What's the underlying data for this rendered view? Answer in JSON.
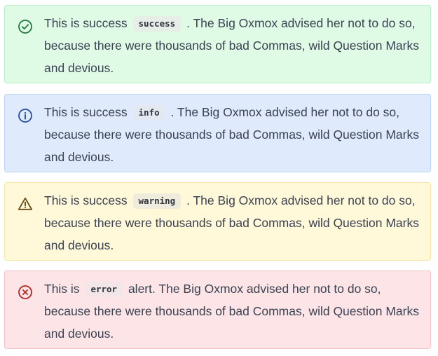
{
  "alerts": [
    {
      "type": "success",
      "icon": "check-circle-icon",
      "color": "#1f7a3a",
      "prefix": "This is success",
      "code": "success",
      "message": ". The Big Oxmox advised her not to do so, because there were thousands of bad Commas, wild Question Marks and devious."
    },
    {
      "type": "info",
      "icon": "info-circle-icon",
      "color": "#1e4fa3",
      "prefix": "This is success",
      "code": "info",
      "message": ". The Big Oxmox advised her not to do so, because there were thousands of bad Commas, wild Question Marks and devious."
    },
    {
      "type": "warning",
      "icon": "warning-triangle-icon",
      "color": "#6b4a12",
      "prefix": "This is success",
      "code": "warning",
      "message": ". The Big Oxmox advised her not to do so, because there were thousands of bad Commas, wild Question Marks and devious."
    },
    {
      "type": "error",
      "icon": "error-circle-icon",
      "color": "#b3261e",
      "prefix": "This is",
      "code": "error",
      "message": "alert. The Big Oxmox advised her not to do so, because there were thousands of bad Commas, wild Question Marks and devious."
    }
  ]
}
